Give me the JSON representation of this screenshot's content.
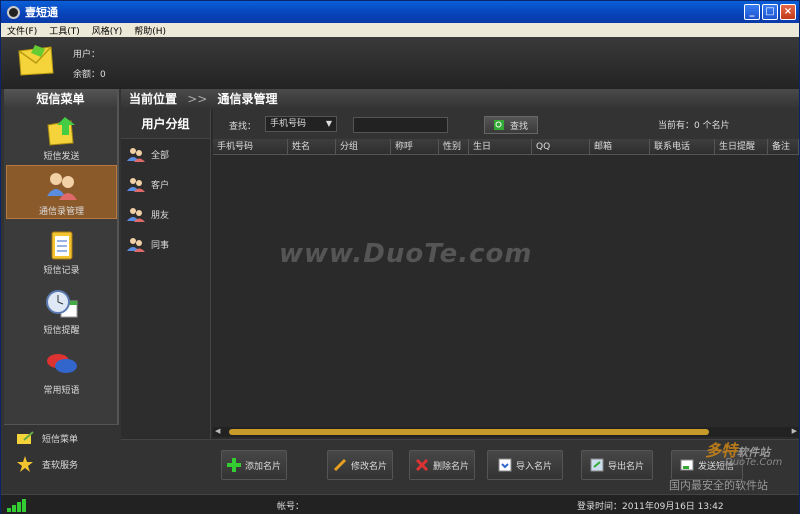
{
  "window": {
    "title": "壹短通"
  },
  "menu": [
    "文件(F)",
    "工具(T)",
    "风格(Y)",
    "帮助(H)"
  ],
  "user": {
    "user_label": "用户：",
    "balance_label": "余额：0"
  },
  "sidebar": {
    "title": "短信菜单",
    "items": [
      {
        "label": "短信发送",
        "icon": "send-envelope-icon"
      },
      {
        "label": "通信录管理",
        "icon": "contacts-icon"
      },
      {
        "label": "短信记录",
        "icon": "clipboard-icon"
      },
      {
        "label": "短信提醒",
        "icon": "clock-calendar-icon"
      },
      {
        "label": "常用短语",
        "icon": "speech-bubble-icon"
      }
    ],
    "active_index": 1,
    "bottom": [
      {
        "label": "短信菜单",
        "icon": "envelope-pen-icon"
      },
      {
        "label": "查软服务",
        "icon": "star-icon"
      }
    ]
  },
  "breadcrumb": {
    "location": "当前位置",
    "separator": ">>",
    "page": "通信录管理"
  },
  "groups": {
    "title": "用户分组",
    "items": [
      "全部",
      "客户",
      "朋友",
      "同事"
    ]
  },
  "toolbar": {
    "search_label": "查找：",
    "field": "手机号码",
    "find_button": "查找",
    "count": "当前有：0 个名片"
  },
  "table": {
    "columns": [
      "手机号码",
      "姓名",
      "分组",
      "称呼",
      "性别",
      "生日",
      "QQ",
      "邮箱",
      "联系电话",
      "生日提醒",
      "备注"
    ],
    "rows": []
  },
  "watermark": "www.DuoTe.com",
  "actions": [
    "添加名片",
    "修改名片",
    "删除名片",
    "导入名片",
    "导出名片",
    "发送短信"
  ],
  "status": {
    "account_label": "帐号：",
    "login_time": "登录时间：2011年09月16日 13:42"
  },
  "corner_watermark": {
    "brand": "多特",
    "brand_suffix": "软件站",
    "url": "DuoTe.Com",
    "slogan": "国内最安全的软件站"
  },
  "colors": {
    "active_nav": "#8b5a2b",
    "scroll_thumb": "#c89a2a",
    "signal": "#33cc33"
  }
}
